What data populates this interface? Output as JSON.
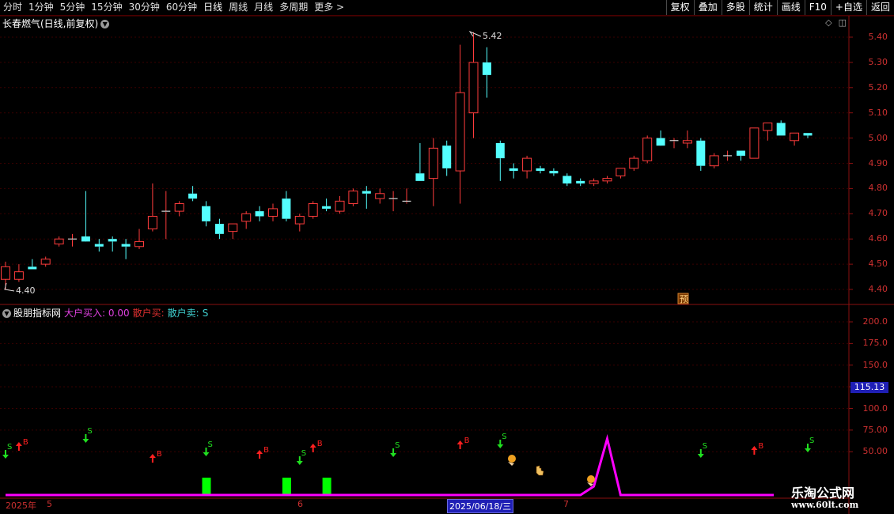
{
  "toolbar": {
    "tabs": [
      "分时",
      "1分钟",
      "5分钟",
      "15分钟",
      "30分钟",
      "60分钟",
      "日线",
      "周线",
      "月线",
      "多周期",
      "更多 >"
    ],
    "active_tab": "日线",
    "right_buttons": [
      "复权",
      "叠加",
      "多股",
      "统计",
      "画线",
      "F10",
      "+自选",
      "返回"
    ]
  },
  "main_chart": {
    "title": "长春燃气(日线,前复权)",
    "y_ticks": [
      "5.40",
      "5.30",
      "5.20",
      "5.10",
      "5.00",
      "4.90",
      "4.80",
      "4.70",
      "4.60",
      "4.50",
      "4.40"
    ],
    "high_label": "5.42",
    "low_label": "4.40",
    "pre_badge": "预"
  },
  "indicator": {
    "name": "股朋指标网",
    "items": [
      {
        "label": "大户买入: 0.00",
        "color": "#e040e0"
      },
      {
        "label": "散户买:",
        "color": "#e03030"
      },
      {
        "label": "散户卖:",
        "color": "#40d0d0"
      },
      {
        "label": "S",
        "color": "#40d0d0"
      }
    ],
    "y_ticks": [
      "200.0",
      "175.0",
      "150.0",
      "125.0",
      "100.0",
      "75.00",
      "50.00"
    ],
    "current_value": "115.13",
    "signal_b": "B",
    "signal_s": "S"
  },
  "x_axis": {
    "labels": [
      "2025年",
      "5",
      "6",
      "2025/06/18/三",
      "7"
    ]
  },
  "watermark": {
    "title": "乐淘公式网",
    "url": "www.60lt.com"
  },
  "chart_data": {
    "type": "candlestick",
    "ylim": [
      4.37,
      5.45
    ],
    "candles": [
      {
        "o": 4.44,
        "h": 4.51,
        "l": 4.4,
        "c": 4.49
      },
      {
        "o": 4.44,
        "h": 4.5,
        "l": 4.43,
        "c": 4.47
      },
      {
        "o": 4.49,
        "h": 4.52,
        "l": 4.48,
        "c": 4.48
      },
      {
        "o": 4.5,
        "h": 4.53,
        "l": 4.49,
        "c": 4.52
      },
      {
        "o": 4.58,
        "h": 4.61,
        "l": 4.57,
        "c": 4.6
      },
      {
        "o": 4.6,
        "h": 4.62,
        "l": 4.57,
        "c": 4.6
      },
      {
        "o": 4.61,
        "h": 4.79,
        "l": 4.6,
        "c": 4.59
      },
      {
        "o": 4.58,
        "h": 4.6,
        "l": 4.55,
        "c": 4.57
      },
      {
        "o": 4.6,
        "h": 4.61,
        "l": 4.55,
        "c": 4.59
      },
      {
        "o": 4.58,
        "h": 4.6,
        "l": 4.52,
        "c": 4.57
      },
      {
        "o": 4.57,
        "h": 4.64,
        "l": 4.56,
        "c": 4.59
      },
      {
        "o": 4.64,
        "h": 4.82,
        "l": 4.63,
        "c": 4.69
      },
      {
        "o": 4.71,
        "h": 4.79,
        "l": 4.6,
        "c": 4.71
      },
      {
        "o": 4.71,
        "h": 4.75,
        "l": 4.69,
        "c": 4.74
      },
      {
        "o": 4.78,
        "h": 4.81,
        "l": 4.75,
        "c": 4.76
      },
      {
        "o": 4.73,
        "h": 4.75,
        "l": 4.65,
        "c": 4.67
      },
      {
        "o": 4.66,
        "h": 4.68,
        "l": 4.6,
        "c": 4.62
      },
      {
        "o": 4.63,
        "h": 4.66,
        "l": 4.6,
        "c": 4.66
      },
      {
        "o": 4.67,
        "h": 4.71,
        "l": 4.64,
        "c": 4.7
      },
      {
        "o": 4.71,
        "h": 4.73,
        "l": 4.67,
        "c": 4.69
      },
      {
        "o": 4.69,
        "h": 4.74,
        "l": 4.67,
        "c": 4.72
      },
      {
        "o": 4.76,
        "h": 4.79,
        "l": 4.67,
        "c": 4.68
      },
      {
        "o": 4.66,
        "h": 4.7,
        "l": 4.63,
        "c": 4.69
      },
      {
        "o": 4.69,
        "h": 4.75,
        "l": 4.68,
        "c": 4.74
      },
      {
        "o": 4.73,
        "h": 4.76,
        "l": 4.71,
        "c": 4.72
      },
      {
        "o": 4.71,
        "h": 4.77,
        "l": 4.7,
        "c": 4.75
      },
      {
        "o": 4.74,
        "h": 4.8,
        "l": 4.73,
        "c": 4.79
      },
      {
        "o": 4.79,
        "h": 4.81,
        "l": 4.72,
        "c": 4.78
      },
      {
        "o": 4.76,
        "h": 4.8,
        "l": 4.74,
        "c": 4.78
      },
      {
        "o": 4.76,
        "h": 4.79,
        "l": 4.71,
        "c": 4.76
      },
      {
        "o": 4.75,
        "h": 4.8,
        "l": 4.74,
        "c": 4.75
      },
      {
        "o": 4.86,
        "h": 4.98,
        "l": 4.83,
        "c": 4.83
      },
      {
        "o": 4.84,
        "h": 5.0,
        "l": 4.73,
        "c": 4.96
      },
      {
        "o": 4.97,
        "h": 4.99,
        "l": 4.85,
        "c": 4.88
      },
      {
        "o": 4.87,
        "h": 5.37,
        "l": 4.74,
        "c": 5.18
      },
      {
        "o": 5.1,
        "h": 5.42,
        "l": 5.0,
        "c": 5.3
      },
      {
        "o": 5.3,
        "h": 5.36,
        "l": 5.16,
        "c": 5.25
      },
      {
        "o": 4.98,
        "h": 4.99,
        "l": 4.83,
        "c": 4.92
      },
      {
        "o": 4.88,
        "h": 4.9,
        "l": 4.84,
        "c": 4.87
      },
      {
        "o": 4.87,
        "h": 4.93,
        "l": 4.84,
        "c": 4.92
      },
      {
        "o": 4.88,
        "h": 4.89,
        "l": 4.86,
        "c": 4.87
      },
      {
        "o": 4.87,
        "h": 4.88,
        "l": 4.85,
        "c": 4.86
      },
      {
        "o": 4.85,
        "h": 4.86,
        "l": 4.81,
        "c": 4.82
      },
      {
        "o": 4.83,
        "h": 4.84,
        "l": 4.81,
        "c": 4.82
      },
      {
        "o": 4.82,
        "h": 4.84,
        "l": 4.81,
        "c": 4.83
      },
      {
        "o": 4.83,
        "h": 4.85,
        "l": 4.82,
        "c": 4.84
      },
      {
        "o": 4.85,
        "h": 4.88,
        "l": 4.84,
        "c": 4.88
      },
      {
        "o": 4.88,
        "h": 4.93,
        "l": 4.87,
        "c": 4.92
      },
      {
        "o": 4.91,
        "h": 5.01,
        "l": 4.9,
        "c": 5.0
      },
      {
        "o": 5.0,
        "h": 5.03,
        "l": 4.98,
        "c": 4.97
      },
      {
        "o": 4.99,
        "h": 5.0,
        "l": 4.96,
        "c": 4.99
      },
      {
        "o": 4.98,
        "h": 5.03,
        "l": 4.96,
        "c": 4.99
      },
      {
        "o": 4.99,
        "h": 5.0,
        "l": 4.87,
        "c": 4.89
      },
      {
        "o": 4.89,
        "h": 4.94,
        "l": 4.88,
        "c": 4.93
      },
      {
        "o": 4.93,
        "h": 4.95,
        "l": 4.91,
        "c": 4.93
      },
      {
        "o": 4.95,
        "h": 4.95,
        "l": 4.91,
        "c": 4.93
      },
      {
        "o": 4.92,
        "h": 5.04,
        "l": 4.92,
        "c": 5.04
      },
      {
        "o": 5.03,
        "h": 5.06,
        "l": 4.99,
        "c": 5.06
      },
      {
        "o": 5.06,
        "h": 5.07,
        "l": 5.01,
        "c": 5.01
      },
      {
        "o": 4.99,
        "h": 5.02,
        "l": 4.97,
        "c": 5.02
      },
      {
        "o": 5.02,
        "h": 5.02,
        "l": 5.0,
        "c": 5.01
      }
    ],
    "indicator_ylim": [
      0,
      215
    ],
    "indicator_line": [
      {
        "i": 0,
        "v": 0
      },
      {
        "i": 43,
        "v": 0
      },
      {
        "i": 44,
        "v": 10
      },
      {
        "i": 45,
        "v": 65
      },
      {
        "i": 46,
        "v": 0
      },
      {
        "i": 57,
        "v": 0
      }
    ],
    "green_bars": [
      {
        "i": 15,
        "v": 20
      },
      {
        "i": 21,
        "v": 20
      },
      {
        "i": 24,
        "v": 20
      }
    ],
    "buy_signals": [
      1,
      11,
      19,
      23,
      34,
      56
    ],
    "sell_signals": [
      0,
      6,
      15,
      22,
      29,
      37,
      52,
      60
    ]
  }
}
